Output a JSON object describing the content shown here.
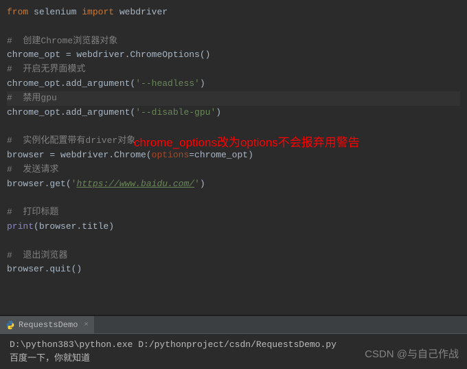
{
  "code": {
    "l1_from": "from",
    "l1_mod": " selenium ",
    "l1_import": "import",
    "l1_name": " webdriver",
    "l3": "#  创建Chrome浏览器对象",
    "l4_a": "chrome_opt = webdriver.ChromeOptions()",
    "l5": "#  开启无界面模式",
    "l6_a": "chrome_opt.add_argument(",
    "l6_s": "'--headless'",
    "l6_b": ")",
    "l7": "#  禁用gpu",
    "l8_a": "chrome_opt.add_argument(",
    "l8_s": "'--disable-gpu'",
    "l8_b": ")",
    "l10": "#  实例化配置带有driver对象",
    "l11_a": "browser = webdriver.Chrome(",
    "l11_p": "options",
    "l11_b": "=chrome_opt)",
    "l12": "#  发送请求",
    "l13_a": "browser.get(",
    "l13_s": "'",
    "l13_u": "https://www.baidu.com/",
    "l13_e": "'",
    "l13_b": ")",
    "l15": "#  打印标题",
    "l16_p": "print",
    "l16_a": "(browser.title)",
    "l18": "#  退出浏览器",
    "l19": "browser.quit()"
  },
  "annotation": "chrome_options改为options不会报弃用警告",
  "terminal": {
    "tab_label": "RequestsDemo",
    "out1": "D:\\python383\\python.exe D:/pythonproject/csdn/RequestsDemo.py",
    "out2": "百度一下，你就知道"
  },
  "watermark": "CSDN @与自己作战"
}
